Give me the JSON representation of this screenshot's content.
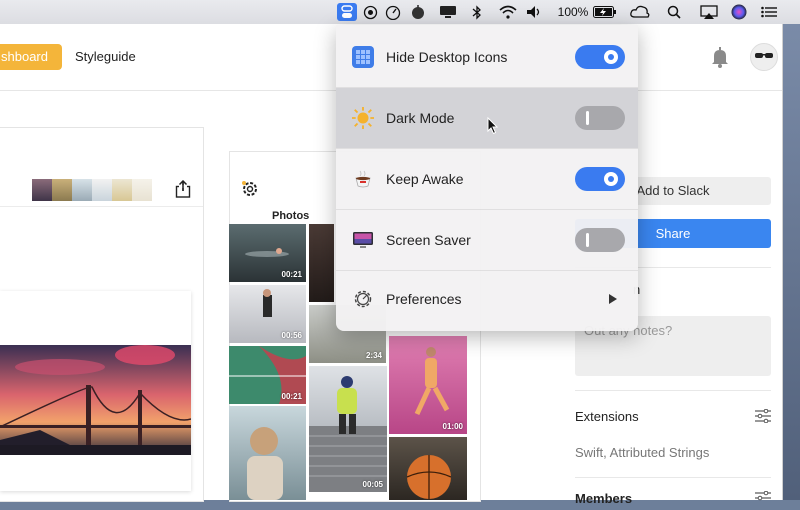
{
  "menubar": {
    "battery_text": "100%",
    "icons": [
      "one-switch-icon",
      "record-icon",
      "speedometer-icon",
      "apple-logo-icon",
      "display-icon",
      "bluetooth-icon",
      "wifi-icon",
      "volume-icon",
      "battery-icon",
      "creative-cloud-icon",
      "search-icon",
      "airplay-icon",
      "siri-icon",
      "list-icon"
    ]
  },
  "app": {
    "nav": {
      "dashboard": "shboard",
      "styleguide": "Styleguide"
    }
  },
  "photos": {
    "label": "Photos",
    "durations": [
      "00:21",
      "00:56",
      "00:21",
      "2:34",
      "01:00",
      "00:05"
    ]
  },
  "right_panel": {
    "add_to_slack": "Add to Slack",
    "share": "Share",
    "notes_heading_fragment": "n",
    "notes_placeholder": "Out any notes?",
    "extensions_title": "Extensions",
    "extensions_value": "Swift, Attributed Strings",
    "members_title": "Members"
  },
  "dropdown": {
    "items": [
      {
        "label": "Hide Desktop Icons",
        "icon": "desktop-grid-icon",
        "toggle": true
      },
      {
        "label": "Dark Mode",
        "icon": "sun-icon",
        "toggle": false
      },
      {
        "label": "Keep Awake",
        "icon": "coffee-cup-icon",
        "toggle": true
      },
      {
        "label": "Screen Saver",
        "icon": "monitor-icon",
        "toggle": false
      },
      {
        "label": "Preferences",
        "icon": "gear-icon",
        "submenu": true
      }
    ]
  },
  "colors": {
    "accent": "#3a7bf0",
    "dashboard": "#f4b53a",
    "share": "#3a86f0"
  }
}
